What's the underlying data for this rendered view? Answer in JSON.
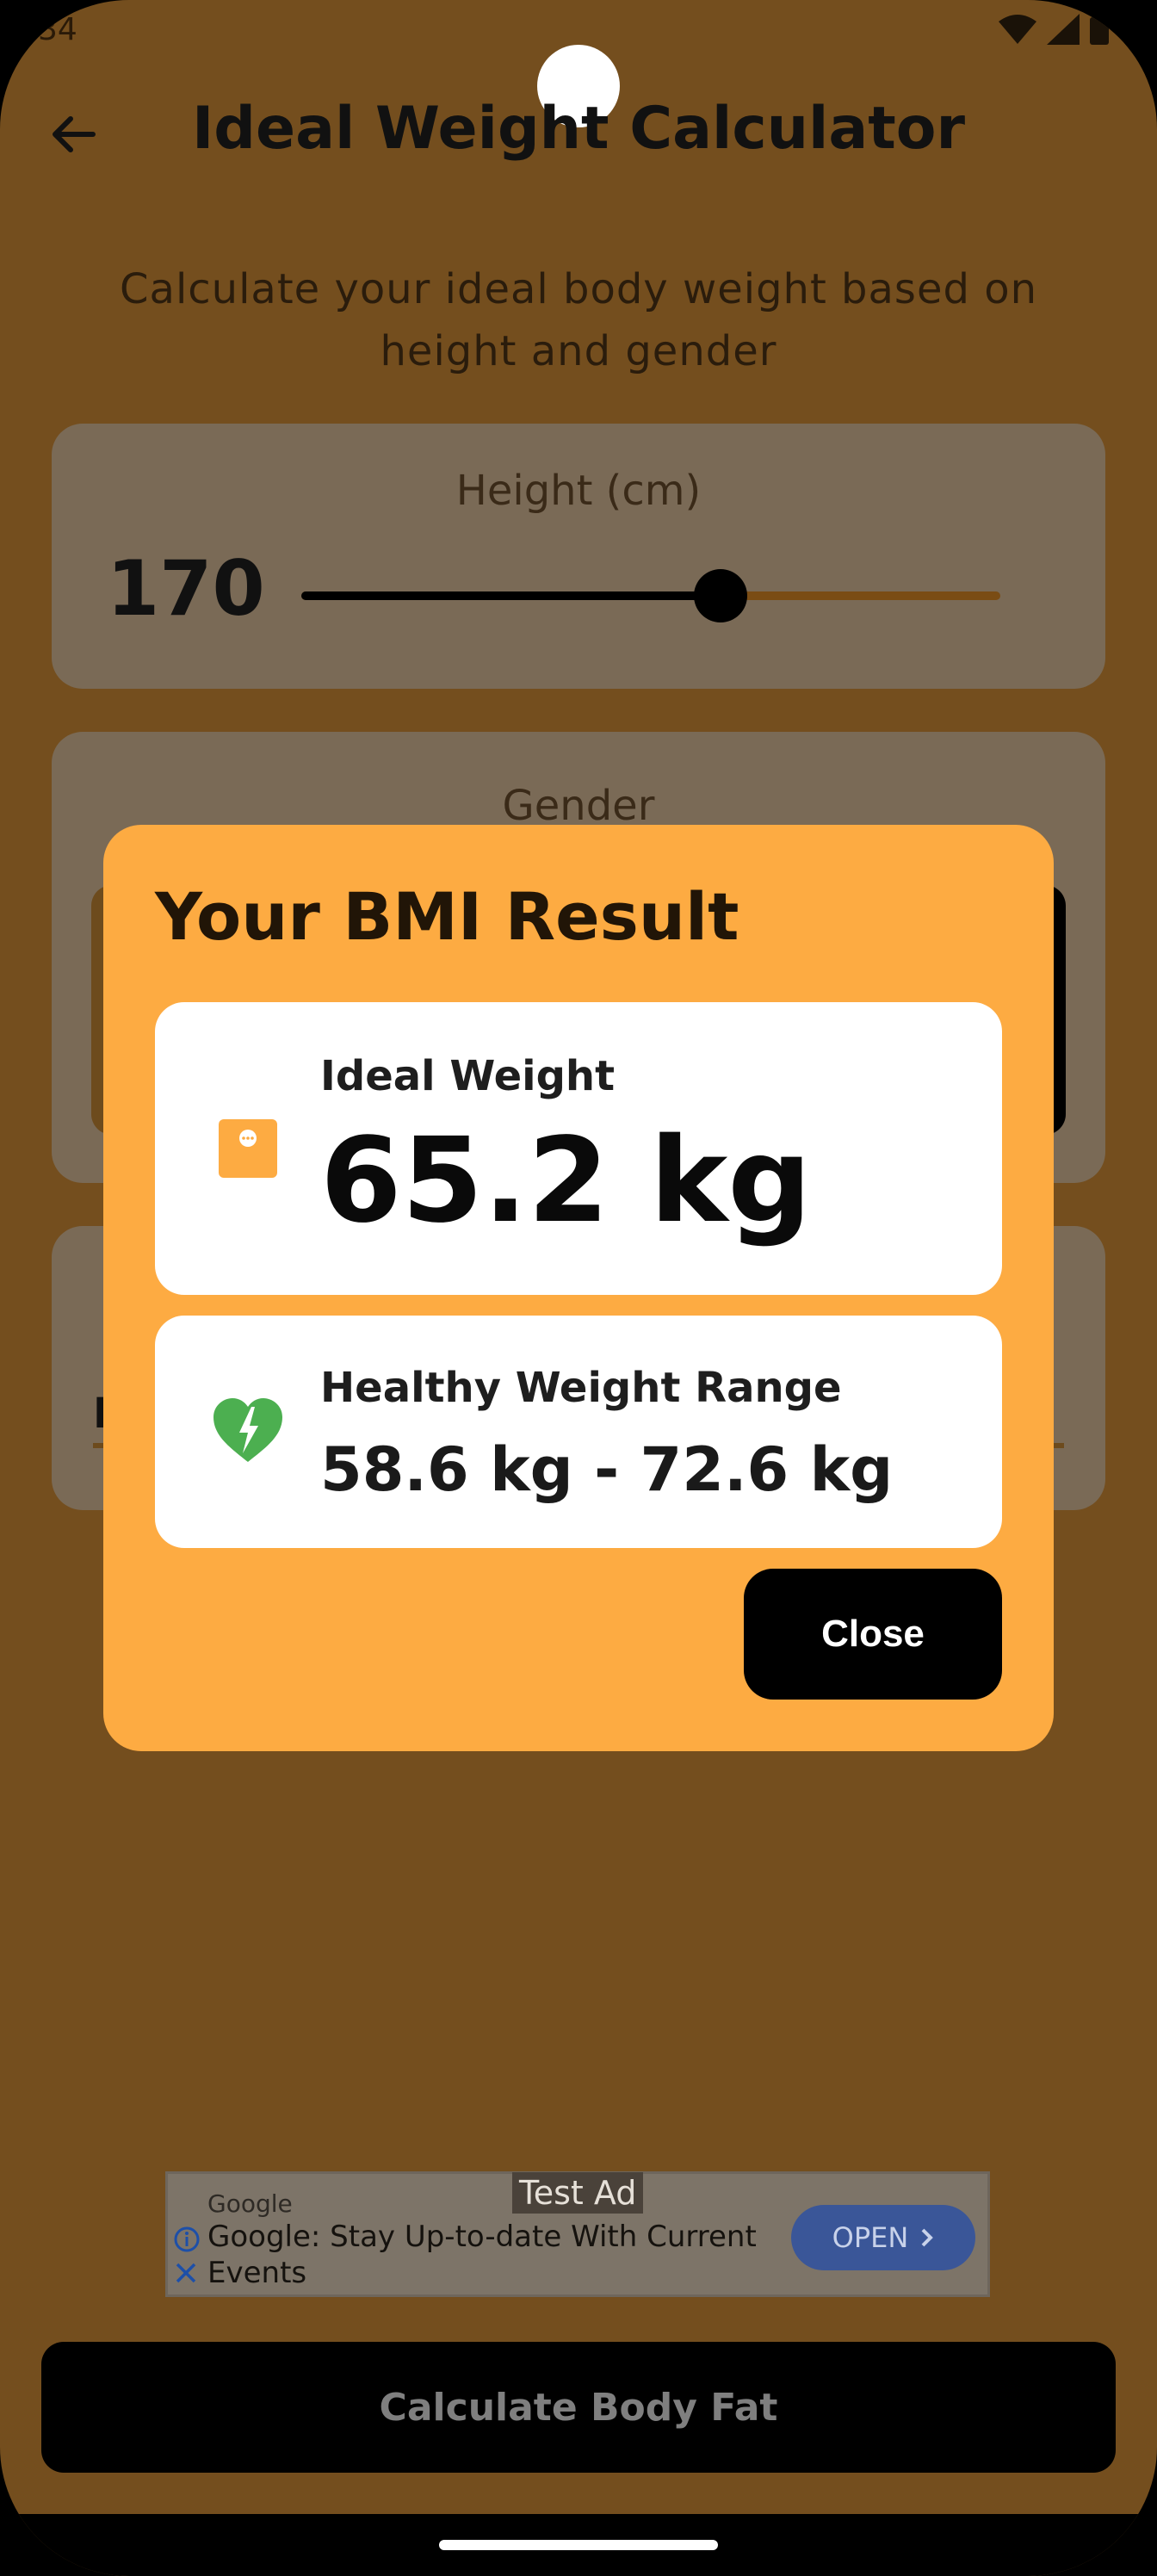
{
  "status_bar": {
    "time": "34"
  },
  "app_bar": {
    "title": "Ideal Weight Calculator"
  },
  "subtitle": "Calculate your ideal body weight based on height and gender",
  "height_card": {
    "label": "Height (cm)",
    "value": "170",
    "slider_fraction": 0.6
  },
  "gender_card": {
    "label": "Gender"
  },
  "third_card": {
    "visible_text": "F"
  },
  "dialog": {
    "title": "Your BMI Result",
    "ideal_weight_label": "Ideal Weight",
    "ideal_weight_value": "65.2 kg",
    "range_label": "Healthy Weight Range",
    "range_value": "58.6 kg - 72.6 kg",
    "close_label": "Close"
  },
  "ad": {
    "brand": "Google",
    "tag": "Test Ad",
    "text": "Google: Stay Up-to-date With Current Events",
    "open_label": "OPEN"
  },
  "cta": {
    "label": "Calculate Body Fat"
  },
  "colors": {
    "background": "#744e1e",
    "dialog": "#fdab42",
    "accent_icon": "#fdab42",
    "heart_icon": "#4caf50"
  }
}
